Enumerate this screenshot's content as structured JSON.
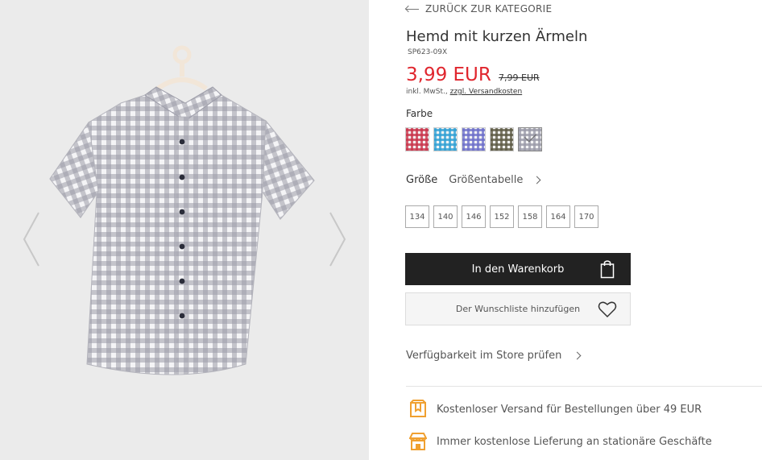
{
  "navigation": {
    "back_label": "ZURÜCK ZUR KATEGORIE"
  },
  "product": {
    "title": "Hemd mit kurzen Ärmeln",
    "sku": "SP623-09X",
    "price": "3,99 EUR",
    "old_price": "7,99 EUR",
    "tax_prefix": "inkl. MwSt.,",
    "shipping_link": "zzgl. Versandkosten"
  },
  "color": {
    "label": "Farbe",
    "swatches": [
      {
        "name": "red-check",
        "color": "#c8344a"
      },
      {
        "name": "blue-check",
        "color": "#2f9fd3"
      },
      {
        "name": "violet-check",
        "color": "#6d6fc9"
      },
      {
        "name": "olive-check",
        "color": "#5d5a44"
      },
      {
        "name": "grey-check",
        "color": "#9a9aa8",
        "selected": true
      }
    ]
  },
  "size": {
    "label": "Größe",
    "table_link": "Größentabelle",
    "options": [
      "134",
      "140",
      "146",
      "152",
      "158",
      "164",
      "170"
    ]
  },
  "actions": {
    "add_to_cart": "In den Warenkorb",
    "wishlist": "Der Wunschliste hinzufügen",
    "store_check": "Verfügbarkeit im Store prüfen"
  },
  "benefits": [
    {
      "icon": "shipping-box-icon",
      "text": "Kostenloser Versand für Bestellungen über 49 EUR"
    },
    {
      "icon": "store-icon",
      "text": "Immer kostenlose Lieferung an stationäre Geschäfte"
    }
  ],
  "colors": {
    "price_red": "#e0262e",
    "button_dark": "#222222",
    "icon_orange": "#f0a030"
  }
}
